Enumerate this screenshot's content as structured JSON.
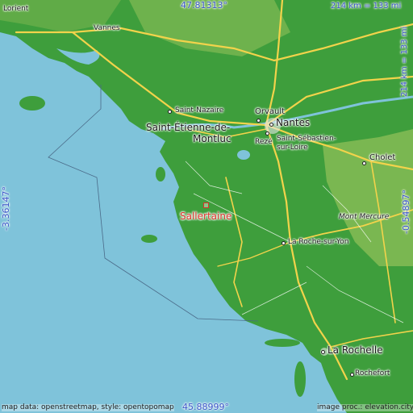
{
  "map": {
    "focus_place": "Sallertaine",
    "colors": {
      "sea": "#7fc3da",
      "land": "#3e9e3c",
      "highland": "#8fbf58",
      "roads": "#f2d34b",
      "coord_text": "#3a56c8",
      "focus": "#d9342b"
    },
    "coords": {
      "north": "47.81313°",
      "south": "45.88999°",
      "west": "-3.36147°",
      "east": "-0.54897°"
    },
    "scale": {
      "horizontal": "214 km = 133 mi",
      "vertical": "214 km = 133 mi"
    },
    "places": {
      "lorient": "Lorient",
      "vannes": "Vannes",
      "saint_nazaire": "Saint-Nazaire",
      "saint_etienne": "Saint-Étienne-de-",
      "montluc": "Montluc",
      "orvault": "Orvault",
      "nantes": "Nantes",
      "reze": "Rezé",
      "saint_sebastien_1": "Saint-Sébastien-",
      "saint_sebastien_2": "sur-Loire",
      "cholet": "Cholet",
      "mont_mercure": "Mont Mercure",
      "la_roche": "La Roche-sur-Yon",
      "la_rochelle": "La Rochelle",
      "rochefort": "Rochefort"
    },
    "attribution": {
      "left": "map data: openstreetmap, style: opentopomap",
      "right": "image proc.: elevation.city"
    }
  }
}
